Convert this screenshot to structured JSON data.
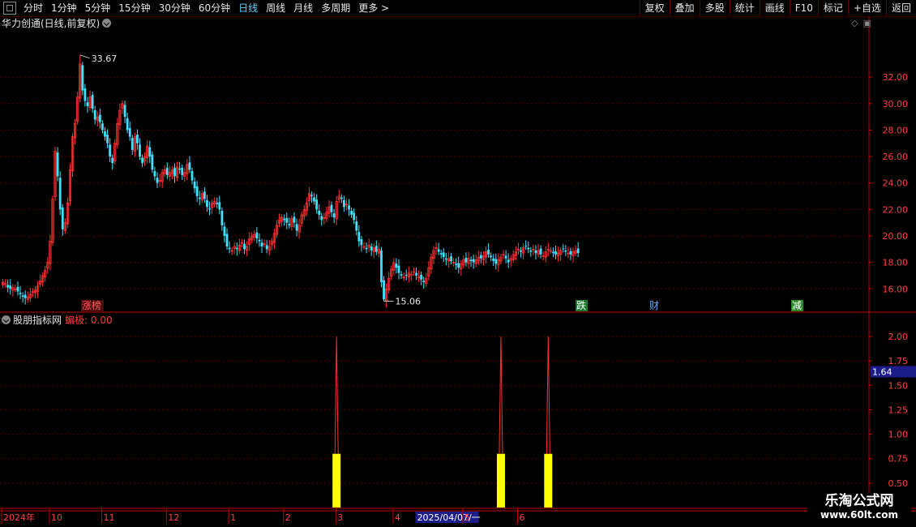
{
  "toolbar": {
    "periods": [
      "分时",
      "1分钟",
      "5分钟",
      "15分钟",
      "30分钟",
      "60分钟",
      "日线",
      "周线",
      "月线",
      "多周期",
      "更多 >"
    ],
    "active_period": "日线",
    "buttons": [
      "复权",
      "叠加",
      "多股",
      "统计",
      "画线",
      "F10",
      "标记",
      "+自选",
      "返回"
    ]
  },
  "main_title": "华力创通(日线,前复权)",
  "indicator": {
    "name": "股朋指标网",
    "label": "蝙极: 0.00"
  },
  "watermark": {
    "title": "乐淘公式网",
    "url": "www.60lt.com"
  },
  "markers": {
    "high_label": "33.67",
    "low_label": "15.06",
    "tags": [
      {
        "text": "涨榜",
        "color": "#ff5a5a",
        "bg": "#4a1010"
      },
      {
        "text": "跌",
        "color": "#ffffff",
        "bg": "#1a7a2a"
      },
      {
        "text": "财",
        "color": "#5fb0ff",
        "bg": "#000000"
      },
      {
        "text": "减",
        "color": "#ffffff",
        "bg": "#2a8a2a"
      }
    ]
  },
  "colors": {
    "up": "#ff3030",
    "down": "#40e0ff",
    "grid": "#5a0000",
    "axis": "#c00000",
    "signal": "#ffff00"
  },
  "chart_data": [
    {
      "type": "candlestick",
      "title": "华力创通(日线,前复权)",
      "y_ticks": [
        16.0,
        18.0,
        20.0,
        22.0,
        24.0,
        26.0,
        28.0,
        30.0,
        32.0
      ],
      "ylim": [
        14.3,
        35.5
      ],
      "x_ticks": [
        "2024年",
        "10",
        "11",
        "12",
        "1",
        "2",
        "3",
        "4",
        "2025/04/07/一",
        "5",
        "6"
      ],
      "x_tick_index": [
        0,
        20,
        41,
        67,
        92,
        114,
        135,
        158,
        167,
        186,
        208
      ],
      "n_bars": 236,
      "high": 33.67,
      "low": 15.06,
      "closes": [
        16.5,
        16.4,
        16.1,
        16.0,
        16.1,
        16.0,
        15.8,
        15.6,
        15.4,
        15.3,
        15.4,
        15.6,
        15.8,
        15.9,
        16.2,
        16.6,
        17.0,
        17.4,
        18.0,
        19.6,
        22.8,
        26.4,
        24.5,
        22.0,
        20.5,
        21.0,
        22.5,
        25.0,
        27.5,
        28.5,
        30.5,
        33.0,
        31.0,
        30.2,
        29.8,
        30.5,
        29.6,
        28.8,
        29.0,
        28.6,
        28.0,
        27.5,
        27.0,
        26.0,
        25.5,
        27.0,
        28.5,
        29.5,
        30.0,
        29.0,
        28.0,
        27.5,
        26.5,
        27.5,
        27.0,
        26.0,
        25.5,
        26.0,
        26.8,
        26.0,
        25.0,
        24.5,
        24.0,
        24.2,
        24.8,
        25.0,
        24.6,
        24.8,
        25.0,
        24.5,
        25.2,
        25.0,
        24.6,
        24.8,
        25.4,
        25.0,
        24.2,
        23.6,
        23.0,
        22.8,
        23.2,
        22.8,
        22.2,
        22.0,
        22.5,
        22.6,
        22.4,
        22.0,
        20.8,
        20.0,
        19.2,
        19.0,
        18.9,
        19.2,
        19.0,
        19.3,
        19.5,
        19.0,
        19.2,
        19.8,
        20.0,
        20.1,
        19.8,
        19.6,
        19.2,
        19.4,
        19.0,
        19.2,
        19.6,
        20.2,
        20.8,
        21.2,
        21.4,
        21.2,
        21.0,
        20.8,
        21.3,
        21.0,
        20.4,
        20.8,
        21.6,
        22.0,
        22.5,
        23.2,
        23.0,
        22.6,
        22.0,
        21.6,
        21.2,
        21.4,
        21.8,
        22.2,
        21.8,
        21.4,
        22.6,
        23.0,
        22.8,
        22.2,
        22.4,
        22.0,
        21.6,
        21.2,
        20.4,
        19.6,
        19.3,
        19.2,
        19.0,
        19.3,
        18.9,
        19.1,
        18.8,
        19.0,
        16.5,
        15.2,
        16.0,
        16.8,
        17.5,
        18.0,
        17.6,
        17.2,
        17.0,
        16.9,
        17.0,
        17.2,
        17.1,
        17.3,
        17.0,
        16.9,
        16.7,
        16.5,
        16.8,
        17.6,
        18.4,
        18.9,
        19.1,
        18.8,
        18.6,
        18.4,
        18.2,
        18.3,
        18.1,
        18.0,
        17.8,
        17.6,
        17.9,
        18.2,
        18.0,
        18.3,
        18.1,
        18.0,
        18.2,
        18.4,
        18.3,
        18.5,
        18.8,
        18.6,
        18.4,
        18.1,
        17.9,
        18.2,
        18.4,
        18.6,
        18.3,
        18.0,
        18.3,
        18.6,
        18.8,
        19.0,
        18.8,
        19.1,
        19.2,
        19.0,
        18.8,
        19.0,
        18.7,
        18.9,
        18.6,
        18.5,
        18.8,
        19.0,
        18.9,
        18.7,
        18.6,
        18.7,
        18.9,
        19.0,
        18.8,
        18.7,
        18.6,
        18.8,
        18.9,
        18.7
      ]
    },
    {
      "type": "bar",
      "title": "股朋指标网",
      "y_ticks": [
        0.5,
        0.75,
        1.0,
        1.25,
        1.5,
        1.75,
        2.0
      ],
      "ylim": [
        0.25,
        2.1
      ],
      "current_value": "1.64",
      "spikes": [
        {
          "index": 134,
          "peak": 2.0,
          "bar": 0.8
        },
        {
          "index": 200,
          "peak": 2.0,
          "bar": 0.8
        },
        {
          "index": 219,
          "peak": 2.0,
          "bar": 0.8
        }
      ]
    }
  ]
}
